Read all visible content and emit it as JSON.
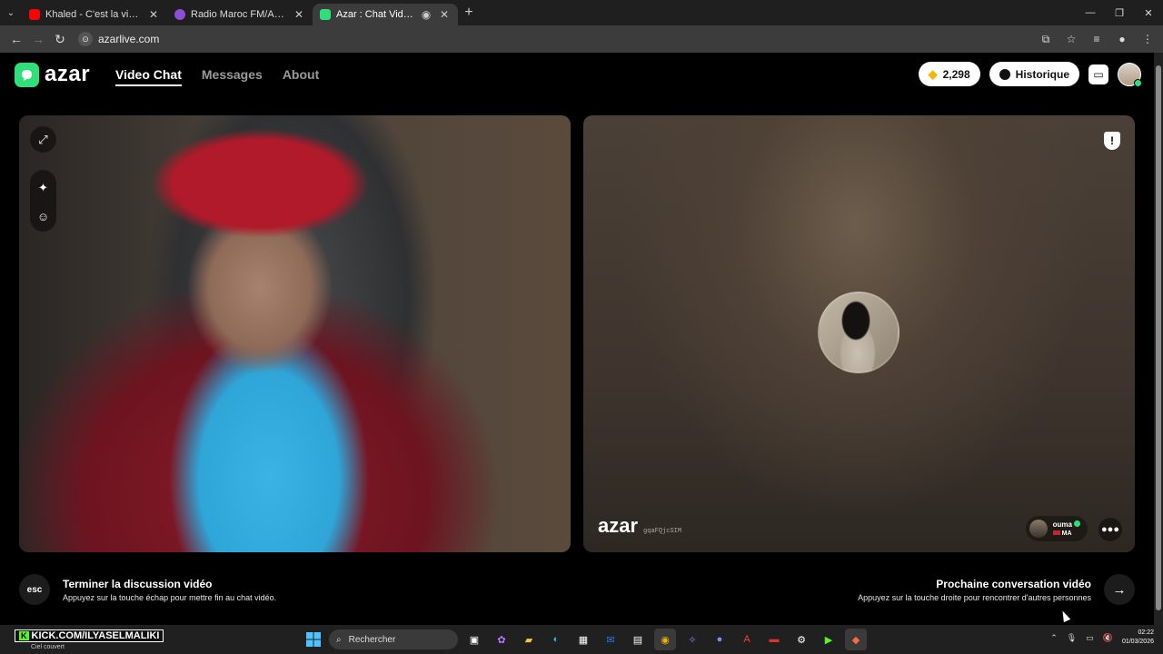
{
  "browser": {
    "tabs": [
      {
        "title": "Khaled - C'est la vie (Clip officiel)",
        "favicon_color": "#ff0000",
        "active": false
      },
      {
        "title": "Radio Maroc FM/AM. Écouter radio",
        "favicon_color": "#8a4fd6",
        "active": false
      },
      {
        "title": "Azar : Chat Vidéo avec de nouvelles",
        "favicon_color": "#2fe07a",
        "active": true
      }
    ],
    "new_tab": "+",
    "url": "azarlive.com"
  },
  "header": {
    "logo": "azar",
    "nav": [
      {
        "label": "Video Chat",
        "active": true
      },
      {
        "label": "Messages",
        "active": false
      },
      {
        "label": "About",
        "active": false
      }
    ],
    "gems": "2,298",
    "history": "Historique"
  },
  "remote": {
    "watermark": "azar",
    "code": "gqaFQjcSIM",
    "partner_name": "ouma",
    "partner_country": "MA"
  },
  "footer": {
    "esc_key": "esc",
    "end_title": "Terminer la discussion vidéo",
    "end_sub": "Appuyez sur la touche échap pour mettre fin au chat vidéo.",
    "next_title": "Prochaine conversation vidéo",
    "next_sub": "Appuyez sur la touche droite pour rencontrer d'autres personnes"
  },
  "taskbar": {
    "weather_label": "KICK.COM/ILYASELMALIKI",
    "weather_sub": "Ciel couvert",
    "search_placeholder": "Rechercher",
    "time": "02:22",
    "date": "01/03/2026"
  },
  "colors": {
    "accent": "#2fe07a",
    "background": "#000000"
  }
}
